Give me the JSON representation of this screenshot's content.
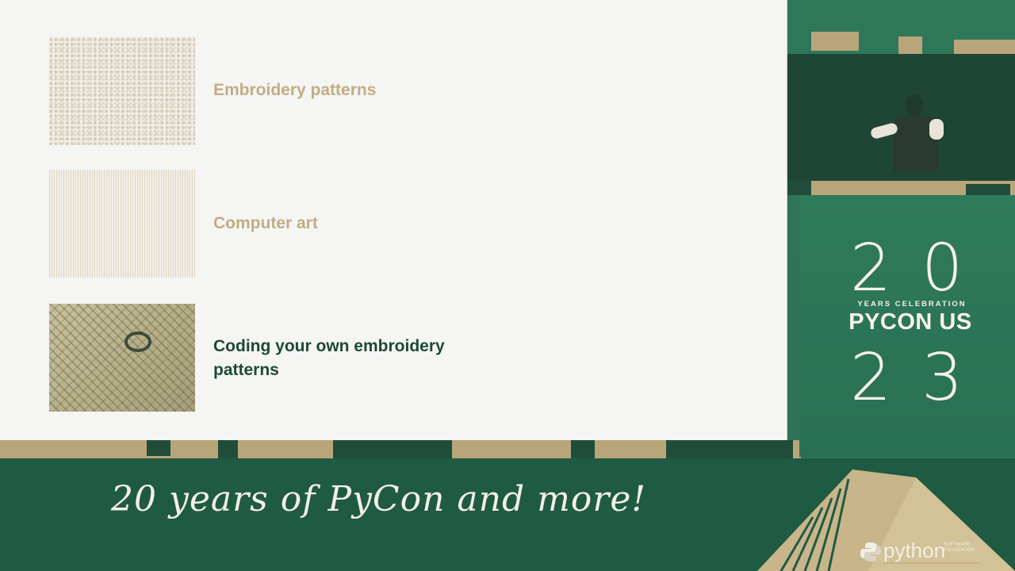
{
  "slide": {
    "items": [
      {
        "label": "Embroidery patterns",
        "state": "dimmed",
        "thumbnail": "embroidery-pattern-image"
      },
      {
        "label": "Computer art",
        "state": "dimmed",
        "thumbnail": "computer-art-image"
      },
      {
        "label": "Coding your own embroidery patterns",
        "state": "active",
        "thumbnail": "embroidery-hoop-photo"
      }
    ]
  },
  "branding": {
    "year_top": "20",
    "years_celebration": "YEARS CELEBRATION",
    "event_name": "PYCON US",
    "year_bottom": "23",
    "tagline": "20 years of PyCon and more!",
    "python_wordmark": "python",
    "psf_line": "SOFTWARE FOUNDATION"
  },
  "colors": {
    "slide_background": "#f5f5f4",
    "dimmed_label": "#c2ad83",
    "active_label": "#1e4a35",
    "brand_green": "#2f7358",
    "banner_green": "#1f5a42",
    "tan_accent": "#b9a57a"
  }
}
